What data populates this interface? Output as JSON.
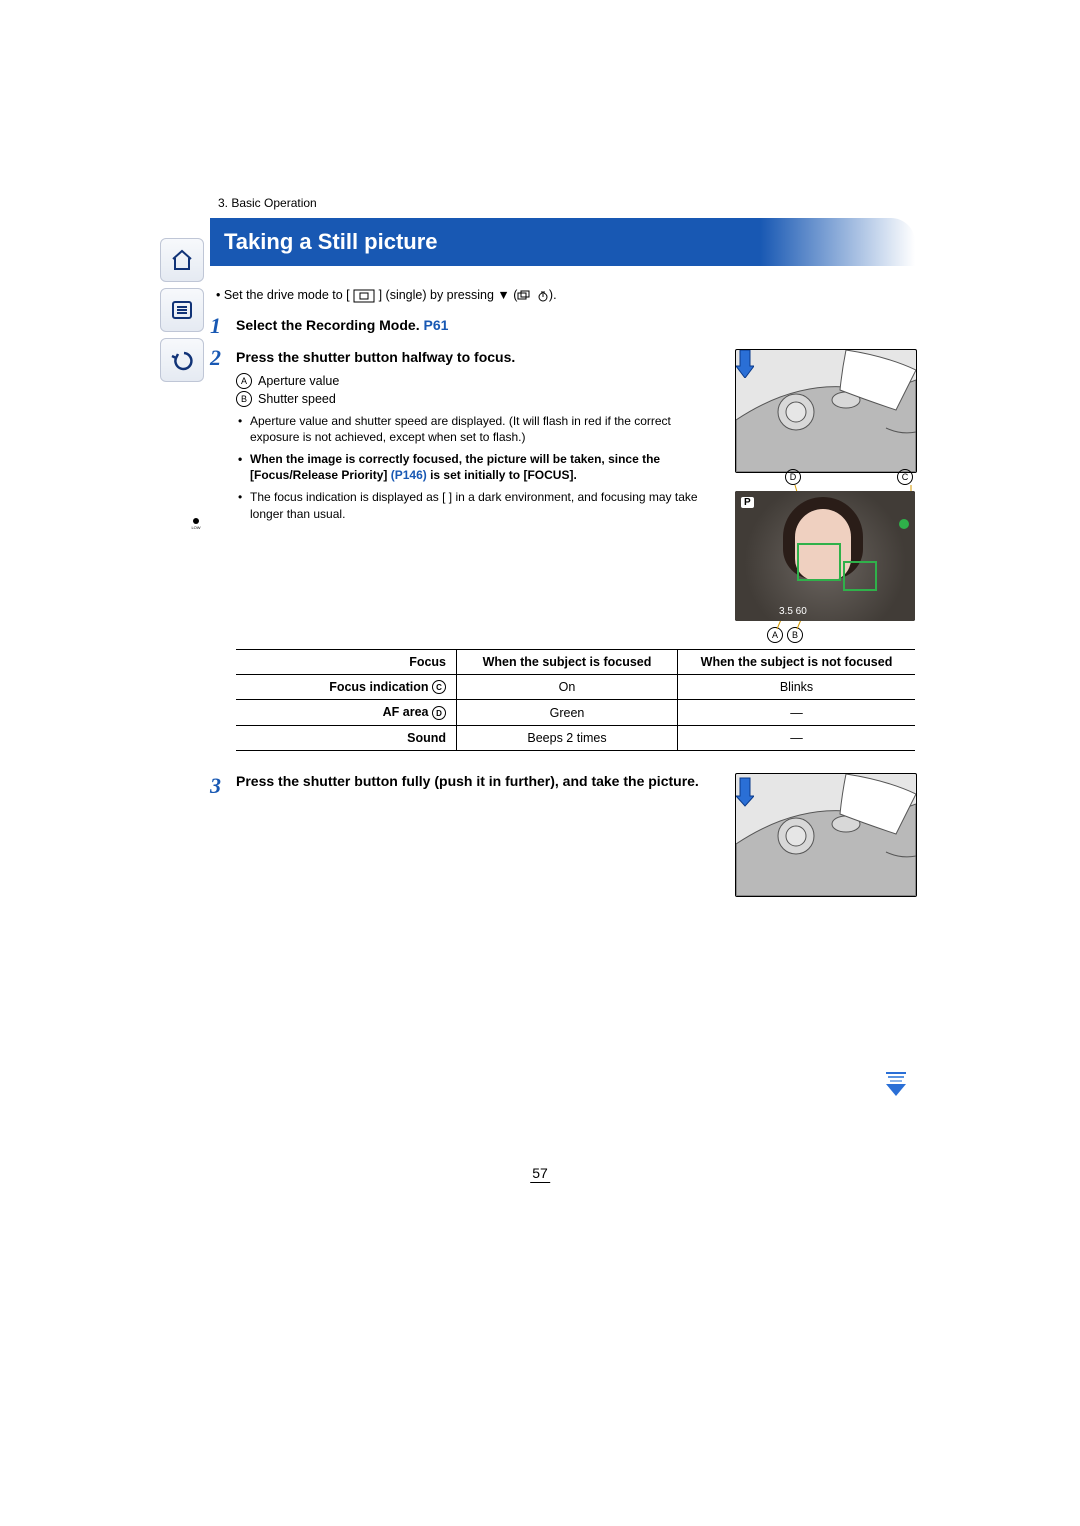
{
  "breadcrumb": "3. Basic Operation",
  "title": "Taking a Still picture",
  "intro": {
    "prefix": "• Set the drive mode to [",
    "mid": "] (single) by pressing ",
    "suffix": ")."
  },
  "steps": {
    "s1": {
      "num": "1",
      "text": "Select the Recording Mode. ",
      "link": "P61"
    },
    "s2": {
      "num": "2",
      "head": "Press the shutter button halfway to focus.",
      "callouts": {
        "A": "Aperture value",
        "B": "Shutter speed"
      },
      "bul1": "Aperture value and shutter speed are displayed. (It will flash in red if the correct exposure is not achieved, except when set to flash.)",
      "bul2_pre": "When the image is correctly focused, the picture will be taken, since the [Focus/Release Priority] ",
      "bul2_link": "(P146)",
      "bul2_post": " is set initially to [FOCUS].",
      "bul3": "The focus indication is displayed as [      ] in a dark environment, and focusing may take longer than usual.",
      "screen": {
        "mode": "P",
        "meta": "3.5 60"
      }
    },
    "s3": {
      "num": "3",
      "head": "Press the shutter button fully (push it in further), and take the picture."
    }
  },
  "table": {
    "header": {
      "c0": "Focus",
      "c1": "When the subject is focused",
      "c2": "When the subject is not focused"
    },
    "rows": [
      {
        "label_pre": "Focus indication ",
        "mark": "C",
        "c1": "On",
        "c2": "Blinks"
      },
      {
        "label_pre": "AF area ",
        "mark": "D",
        "c1": "Green",
        "c2": "—"
      },
      {
        "label_pre": "Sound",
        "mark": "",
        "c1": "Beeps 2 times",
        "c2": "—"
      }
    ]
  },
  "page_number": "57",
  "sidebar": {
    "home": "home-icon",
    "menu": "menu-icon",
    "back": "back-icon"
  },
  "screen_labels": {
    "A": "A",
    "B": "B",
    "C": "C",
    "D": "D"
  }
}
